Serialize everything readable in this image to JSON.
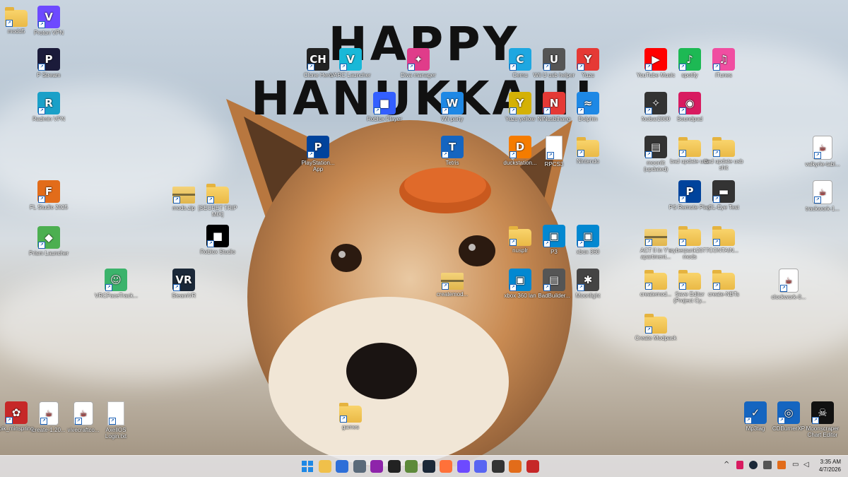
{
  "banner": {
    "text": "HAPPY HANUKKAH!"
  },
  "desktop_icons": [
    {
      "label": "modd5",
      "glyph": "folder",
      "color": "#f0c04a"
    },
    {
      "label": "Proton VPN",
      "glyph": "V",
      "color": "#6d4aff"
    },
    {
      "label": "P Stream",
      "glyph": "P",
      "color": "#1b1b3a"
    },
    {
      "label": "Radmin VPN",
      "glyph": "R",
      "color": "#1aa0c8"
    },
    {
      "label": "FL Studio 2025",
      "glyph": "F",
      "color": "#e26c1a"
    },
    {
      "label": "Prism Launcher",
      "glyph": "◆",
      "color": "#4caf50"
    },
    {
      "label": "VRCFaceTrack...",
      "glyph": "☺",
      "color": "#3bb36b"
    },
    {
      "label": "SteamVR",
      "glyph": "VR",
      "color": "#1b2838"
    },
    {
      "label": "mods.zip",
      "glyph": "zip",
      "color": "#e0b54c"
    },
    {
      "label": "[SECRET TRIP MIX]",
      "glyph": "folder",
      "color": "#f0c04a"
    },
    {
      "label": "Roblox Studio",
      "glyph": "■",
      "color": "#000000"
    },
    {
      "label": "Clone Hero",
      "glyph": "CH",
      "color": "#222222"
    },
    {
      "label": "PlayStation... App",
      "glyph": "P",
      "color": "#00439c"
    },
    {
      "label": "VARC Launcher",
      "glyph": "V",
      "color": "#19b8d8"
    },
    {
      "label": "Roblox Player",
      "glyph": "■",
      "color": "#335fff"
    },
    {
      "label": "Diva manager",
      "glyph": "✦",
      "color": "#e03c8a"
    },
    {
      "label": "Wii party",
      "glyph": "W",
      "color": "#1e88e5"
    },
    {
      "label": "Tetris",
      "glyph": "T",
      "color": "#1565c0"
    },
    {
      "label": "Cemu",
      "glyph": "C",
      "color": "#1ea7e1"
    },
    {
      "label": "Yuzu yellow",
      "glyph": "Y",
      "color": "#d4b106"
    },
    {
      "label": "duckstation...",
      "glyph": "D",
      "color": "#f57c00"
    },
    {
      "label": "nusplr",
      "glyph": "folder",
      "color": "#f0c04a"
    },
    {
      "label": "createmod...",
      "glyph": "zip",
      "color": "#e0b54c"
    },
    {
      "label": "Wii U usb helper",
      "glyph": "U",
      "color": "#555555"
    },
    {
      "label": "NINusbthang",
      "glyph": "N",
      "color": "#e53935"
    },
    {
      "label": "RPCS3",
      "glyph": "doc",
      "color": "#ffffff"
    },
    {
      "label": "P3",
      "glyph": "▣",
      "color": "#0288d1"
    },
    {
      "label": "xbox 360 lan",
      "glyph": "▣",
      "color": "#0288d1"
    },
    {
      "label": "BadBuilder...",
      "glyph": "▤",
      "color": "#555555"
    },
    {
      "label": "Yuzu",
      "glyph": "Y",
      "color": "#e53935"
    },
    {
      "label": "Dolphin",
      "glyph": "≈",
      "color": "#1e88e5"
    },
    {
      "label": "Nintendo",
      "glyph": "folder",
      "color": "#f0c04a"
    },
    {
      "label": "xbox 360",
      "glyph": "▣",
      "color": "#0288d1"
    },
    {
      "label": "Moonlight",
      "glyph": "✱",
      "color": "#444444"
    },
    {
      "label": "YouTube Music",
      "glyph": "▶",
      "color": "#ff0000"
    },
    {
      "label": "spotify",
      "glyph": "♪",
      "color": "#1db954"
    },
    {
      "label": "iTunes",
      "glyph": "♫",
      "color": "#f04ea1"
    },
    {
      "label": "foobar2000",
      "glyph": "✧",
      "color": "#333333"
    },
    {
      "label": "Soundpad",
      "glyph": "◉",
      "color": "#d81b60"
    },
    {
      "label": "moonlit (updated)",
      "glyph": "▤",
      "color": "#333333"
    },
    {
      "label": "bad update usb",
      "glyph": "folder",
      "color": "#f0c04a"
    },
    {
      "label": "bad update usb shit",
      "glyph": "folder",
      "color": "#f0c04a"
    },
    {
      "label": "PS Remote Play",
      "glyph": "P",
      "color": "#00439c"
    },
    {
      "label": "CL-Eye Test",
      "glyph": "▬",
      "color": "#333333"
    },
    {
      "label": "ACT II in Y's apartment...",
      "glyph": "zip",
      "color": "#e0b54c"
    },
    {
      "label": "cyberpunk2077 mods",
      "glyph": "folder",
      "color": "#f0c04a"
    },
    {
      "label": "CONTAIN...",
      "glyph": "folder",
      "color": "#f0c04a"
    },
    {
      "label": "createmod...",
      "glyph": "folder",
      "color": "#f0c04a"
    },
    {
      "label": "Save Editor (Project Cy...",
      "glyph": "folder",
      "color": "#f0c04a"
    },
    {
      "label": "create-NBTs",
      "glyph": "folder",
      "color": "#f0c04a"
    },
    {
      "label": "Create Modpack",
      "glyph": "folder",
      "color": "#f0c04a"
    },
    {
      "label": "valkyrie-tabi...",
      "glyph": "java",
      "color": "#ffffff"
    },
    {
      "label": "trackwork-1...",
      "glyph": "java",
      "color": "#ffffff"
    },
    {
      "label": "clockwork-0...",
      "glyph": "java",
      "color": "#ffffff"
    },
    {
      "label": "pik_minspring",
      "glyph": "✿",
      "color": "#c62828"
    },
    {
      "label": "create-1.20...",
      "glyph": "java",
      "color": "#ffffff"
    },
    {
      "label": "vivecraftco...",
      "glyph": "java",
      "color": "#ffffff"
    },
    {
      "label": "AxellOS Login.txt",
      "glyph": "doc",
      "color": "#ffffff"
    },
    {
      "label": "games",
      "glyph": "folder",
      "color": "#f0c04a"
    },
    {
      "label": "Mp3tag",
      "glyph": "✓",
      "color": "#1565c0"
    },
    {
      "label": "CDBurnerXP",
      "glyph": "◎",
      "color": "#1565c0"
    },
    {
      "label": "Moonscraper Chart Editor",
      "glyph": "☠",
      "color": "#111111"
    }
  ],
  "taskbar": {
    "icons": [
      {
        "name": "start",
        "color": "#1e88e5"
      },
      {
        "name": "file-explorer",
        "color": "#f0c04a"
      },
      {
        "name": "photos",
        "color": "#2e6fd8"
      },
      {
        "name": "settings",
        "color": "#5a6a7a"
      },
      {
        "name": "app-purple",
        "color": "#8e24aa"
      },
      {
        "name": "obs",
        "color": "#222222"
      },
      {
        "name": "minecraft",
        "color": "#5d8a3a"
      },
      {
        "name": "steam",
        "color": "#1b2838"
      },
      {
        "name": "firefox",
        "color": "#ff7139"
      },
      {
        "name": "proton-vpn",
        "color": "#6d4aff"
      },
      {
        "name": "discord",
        "color": "#5865f2"
      },
      {
        "name": "foobar",
        "color": "#333333"
      },
      {
        "name": "fl-studio",
        "color": "#e26c1a"
      },
      {
        "name": "app-red",
        "color": "#c62828"
      }
    ],
    "tray_chevron": "^",
    "clock_time": "3:35 AM",
    "clock_date": "4/7/2026"
  }
}
